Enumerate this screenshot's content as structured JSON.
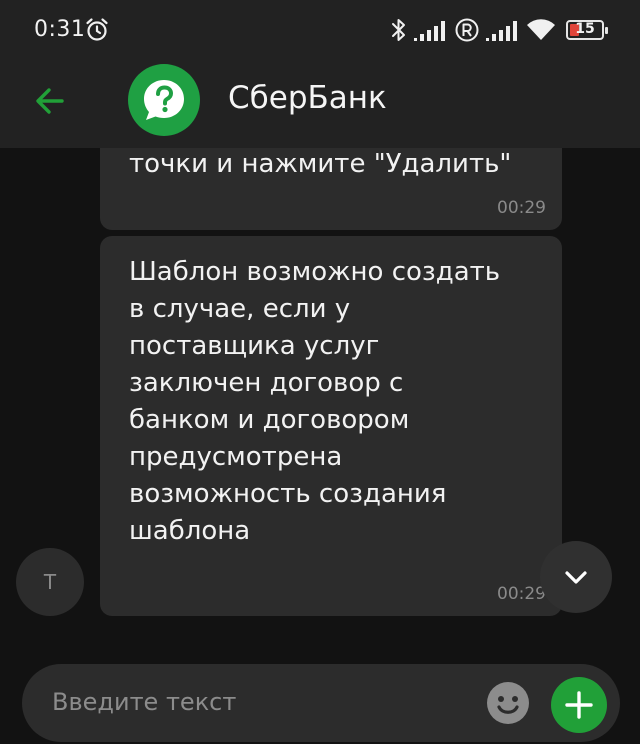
{
  "status_bar": {
    "time": "0:31",
    "battery_level": "15",
    "icons": [
      "alarm-icon",
      "bluetooth-icon",
      "signal-icon",
      "roaming-icon",
      "signal-icon",
      "wifi-icon",
      "battery-icon"
    ]
  },
  "header": {
    "back_icon": "arrow-left-icon",
    "avatar_icon": "question-bubble-icon",
    "title": "СберБанк"
  },
  "messages": [
    {
      "text": "точки и нажмите \"Удалить\"",
      "time": "00:29"
    },
    {
      "text": "Шаблон возможно создать\nв случае, если у\nпоставщика услуг\nзаключен договор с\nбанком и договором\nпредусмотрена\nвозможность создания\nшаблона",
      "time": "00:29"
    }
  ],
  "sender_avatar_letter": "Т",
  "scroll_button_icon": "chevron-down-icon",
  "input": {
    "placeholder": "Введите текст",
    "emoji_icon": "emoji-icon",
    "add_icon": "plus-icon"
  },
  "colors": {
    "accent": "#21a038",
    "background": "#121212",
    "bubble": "#2c2c2c",
    "header": "#222222"
  }
}
